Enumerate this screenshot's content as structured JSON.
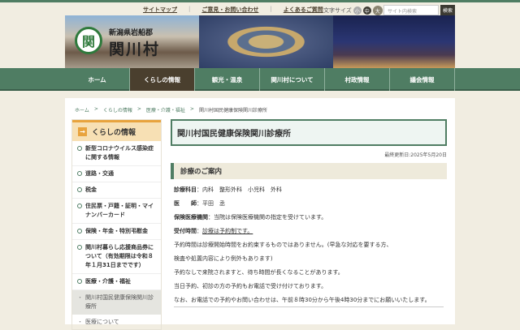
{
  "top": {
    "links": [
      "サイトマップ",
      "ご意見・お問い合わせ",
      "よくあるご質問"
    ],
    "fontsize_label": "文字サイズ",
    "fontsize_options": [
      "小",
      "中",
      "大"
    ],
    "search_placeholder": "サイト内検索",
    "search_button": "検索"
  },
  "banner": {
    "prefecture": "新潟県岩船郡",
    "village": "関川村",
    "logo_mark": "関"
  },
  "nav": [
    "ホーム",
    "くらしの情報",
    "観光・温泉",
    "関川村について",
    "村政情報",
    "議会情報"
  ],
  "breadcrumb": [
    "ホーム",
    "くらしの情報",
    "医療・介護・福祉",
    "関川村国民健康保険関川診療所"
  ],
  "sidebar": {
    "title": "くらしの情報",
    "items": [
      "新型コロナウイルス感染症に関する情報",
      "道路・交通",
      "税金",
      "住民票・戸籍・証明・マイナンバーカード",
      "保険・年金・特別弔慰金",
      "関川村暮らし応援商品券について（有効期限は令和８年１月31日までです）",
      "医療・介護・福祉"
    ],
    "subitems": [
      "関川村国民健康保険関川診療所",
      "医療について"
    ]
  },
  "main": {
    "title": "関川村国民健康保険関川診療所",
    "updated": "最終更新日:2025年5月20日",
    "section": "診療のご案内",
    "rows": [
      {
        "label": "診療科目",
        "value": "：内科　整形外科　小児科　外科"
      },
      {
        "label": "医　　師",
        "value": "：平田　丞"
      },
      {
        "label": "保険医療機関",
        "value": "：当院は保険医療機関の指定を受けています。"
      },
      {
        "label": "受付時間",
        "value": "：",
        "link": "診療は予約制です。"
      }
    ],
    "paragraphs": [
      "予約時間は診療開始時間をお約束するものではありません。(早急な対応を要する方、",
      "検査や処置内容により例外もあります)",
      "予約なしで来院されますと、待ち時間が長くなることがあります。",
      "当日予約、初診の方の予約もお電話で受け付けております。",
      "なお、お電話での予約やお問い合わせは、午前８時30分から午後4時30分までにお願いいたします。"
    ]
  }
}
